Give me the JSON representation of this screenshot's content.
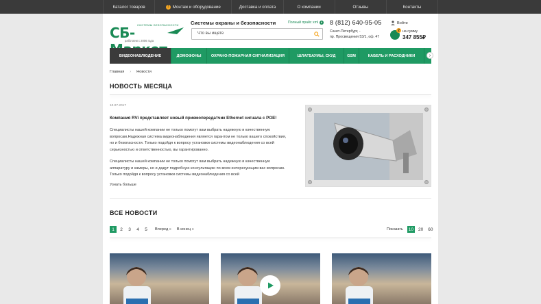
{
  "topnav": {
    "items": [
      "Каталог товаров",
      "Монтаж и оборудование",
      "Доставка и оплата",
      "О компании",
      "Отзывы",
      "Контакты"
    ],
    "badge": "!"
  },
  "header": {
    "logo": "СБ-Маркет",
    "logo_tag": "СИСТЕМЫ БЕЗОПАСНОСТИ",
    "logo_sub": "работаем с 2006 года",
    "tagline": "Системы охраны и безопасности",
    "price_link": "Полный прайс xml",
    "search_placeholder": "Что вы ищете",
    "phone": "8 (812) 640-95-05",
    "address_line1": "Санкт-Петербург, -",
    "address_line2": "пр. Просвещения 53/1, оф. 47",
    "login": "Войти",
    "cart_count": "2",
    "cart_label": "на сумму",
    "cart_sum": "347 855₽"
  },
  "categories": [
    "ВИДЕОНАБЛЮДЕНИЕ",
    "ДОМОФОНЫ",
    "ОХРАНО-ПОЖАРНАЯ СИГНАЛИЗАЦИЯ",
    "ШЛАГБАУМЫ, СКУД",
    "GSM",
    "КАБЕЛЬ И РАСХОДНИКИ"
  ],
  "breadcrumb": {
    "home": "Главная",
    "sep": "›",
    "current": "Новости"
  },
  "news_of_month": {
    "heading": "НОВОСТЬ МЕСЯЦА",
    "date": "10.07.2017",
    "title": "Компания RVi представляет новый приемопередатчик Ethernet сигнала с POE!",
    "para1": "Специалисты нашей компании не только помогут вам выбрать надежную и качественную вопросам.Надежная система видеонаблюдения является гарантом не только вашего спокойствия, но и безопасности. Только подойдя к вопросу установки системы видеонаблюдения со всей серьезностью и ответственностью, вы гарантированно.",
    "para2": "Специалисты нашей компании не только помогут вам выбрать надежную и качественную аппаратуру и камеры, но и дадут подробную консультацию по всем интересующим вас вопросам. Только подойдя к вопросу установки системы видеонаблюдения со всей",
    "more": "Узнать больше"
  },
  "all_news": {
    "heading": "ВСЕ НОВОСТИ",
    "pages": [
      "1",
      "2",
      "3",
      "4",
      "5"
    ],
    "active_page": "1",
    "next": "Вперед »",
    "last": "В конец »",
    "show_label": "Показать",
    "show_options": [
      "10",
      "20",
      "60"
    ],
    "show_active": "10"
  },
  "colors": {
    "brand": "#1f9a63",
    "accent": "#f5a623",
    "dark": "#3a3a3a"
  }
}
